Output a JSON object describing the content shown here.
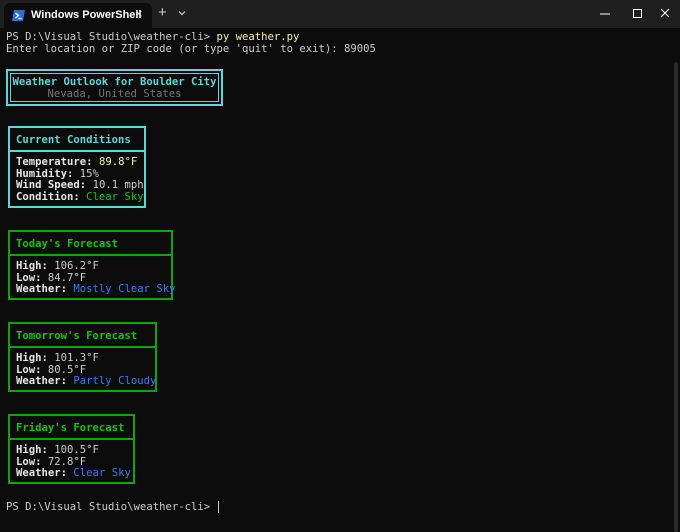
{
  "window": {
    "tab_title": "Windows PowerShell",
    "tab_close": "×",
    "new_tab": "+",
    "controls": {
      "minimize": "minimize",
      "maximize": "maximize",
      "close": "close"
    }
  },
  "terminal": {
    "prompt1": "PS D:\\Visual Studio\\weather-cli> ",
    "command": "py weather.py",
    "input_prompt": "Enter location or ZIP code (or type 'quit' to exit): 89005",
    "header": {
      "title": "Weather Outlook for Boulder City",
      "subtitle": "Nevada, United States"
    },
    "current": {
      "heading": "Current Conditions",
      "temp_label": "Temperature:",
      "temp_value": "89.8°F",
      "humidity_label": "Humidity:",
      "humidity_value": "15%",
      "wind_label": "Wind Speed:",
      "wind_value": "10.1 mph",
      "condition_label": "Condition:",
      "condition_value": "Clear Sky"
    },
    "forecasts": [
      {
        "heading": "Today's Forecast",
        "high_label": "High:",
        "high": "106.2°F",
        "low_label": "Low:",
        "low": "84.7°F",
        "weather_label": "Weather:",
        "weather": "Mostly Clear Sky"
      },
      {
        "heading": "Tomorrow's Forecast",
        "high_label": "High:",
        "high": "101.3°F",
        "low_label": "Low:",
        "low": "80.5°F",
        "weather_label": "Weather:",
        "weather": "Partly Cloudy"
      },
      {
        "heading": "Friday's Forecast",
        "high_label": "High:",
        "high": "100.5°F",
        "low_label": "Low:",
        "low": "72.8°F",
        "weather_label": "Weather:",
        "weather": "Clear Sky"
      }
    ],
    "prompt_final": "PS D:\\Visual Studio\\weather-cli> "
  },
  "colors": {
    "cyan": "#61d6d6",
    "green": "#13a10e",
    "yellow": "#f9f1a5",
    "blue": "#3b78ff",
    "gray": "#767676"
  }
}
